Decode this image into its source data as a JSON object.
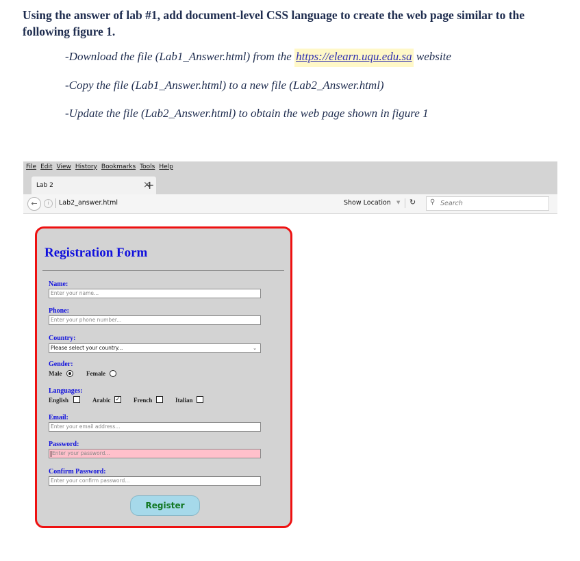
{
  "doc": {
    "heading": "Using the answer of lab #1, add document-level CSS language to create the web page similar to the following figure 1.",
    "instructions": [
      {
        "prefix": "-Download the file (Lab1_Answer.html) from the ",
        "link": "https://elearn.uqu.edu.sa",
        "suffix": " website"
      },
      {
        "text": "-Copy the file (Lab1_Answer.html) to a new file (Lab2_Answer.html)"
      },
      {
        "text": "-Update the file (Lab2_Answer.html) to obtain the web page shown in figure 1"
      }
    ]
  },
  "browser": {
    "menu": [
      "File",
      "Edit",
      "View",
      "History",
      "Bookmarks",
      "Tools",
      "Help"
    ],
    "tab_title": "Lab 2",
    "tab_close": "×",
    "new_tab": "+",
    "url": "Lab2_answer.html",
    "show_location": "Show Location",
    "search_placeholder": "Search"
  },
  "form": {
    "title": "Registration Form",
    "name_label": "Name:",
    "name_placeholder": "Enter your name...",
    "phone_label": "Phone:",
    "phone_placeholder": "Enter your phone number...",
    "country_label": "Country:",
    "country_selected": "Please select your country...",
    "gender_label": "Gender:",
    "gender_options": [
      {
        "label": "Male",
        "checked": true
      },
      {
        "label": "Female",
        "checked": false
      }
    ],
    "languages_label": "Languages:",
    "language_options": [
      {
        "label": "English",
        "checked": false
      },
      {
        "label": "Arabic",
        "checked": true
      },
      {
        "label": "French",
        "checked": false
      },
      {
        "label": "Italian",
        "checked": false
      }
    ],
    "email_label": "Email:",
    "email_placeholder": "Enter your email address...",
    "password_label": "Password:",
    "password_placeholder": "Enter your password...",
    "confirm_label": "Confirm Password:",
    "confirm_placeholder": "Enter your confirm  password...",
    "register_label": "Register"
  },
  "colors": {
    "form_border": "#ee1111",
    "form_background": "#d3d3d3",
    "label_color": "#1010dd",
    "password_background": "#ffc0cb",
    "button_background": "#a6d9ea",
    "button_text": "#117722"
  }
}
